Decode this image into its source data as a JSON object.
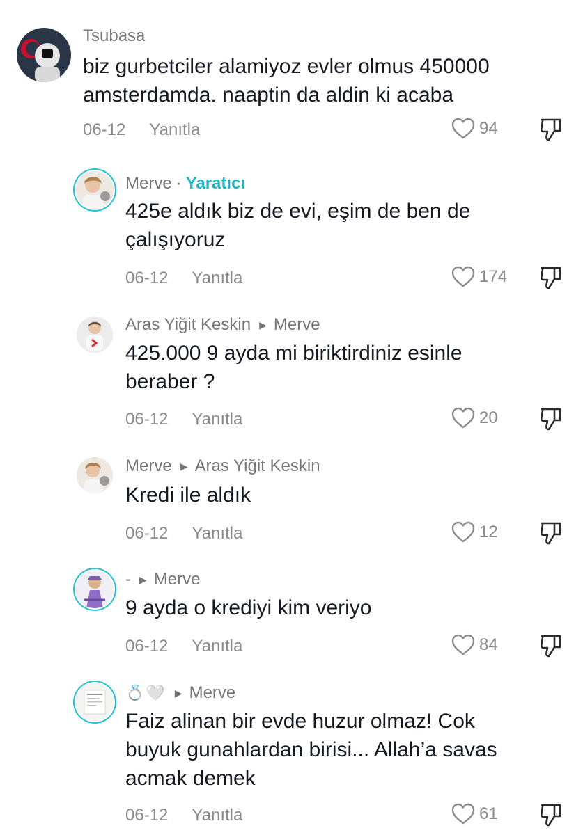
{
  "comments": [
    {
      "username": "Tsubasa",
      "text_lines": [
        "biz gurbetciler alamiyoz evler olmus 450000",
        "amsterdamda. naaptin da aldin ki acaba"
      ],
      "date": "06-12",
      "reply_label": "Yanıtla",
      "likes": "94"
    },
    {
      "username": "Merve",
      "separator": "·",
      "badge": "Yaratıcı",
      "text_lines": [
        "425e aldık biz de evi, eşim de ben de",
        "çalışıyoruz"
      ],
      "date": "06-12",
      "reply_label": "Yanıtla",
      "likes": "174"
    },
    {
      "username": "Aras Yiğit Keskin",
      "reply_to": "Merve",
      "text_lines": [
        "425.000 9 ayda mi biriktirdiniz esinle",
        "beraber ?"
      ],
      "date": "06-12",
      "reply_label": "Yanıtla",
      "likes": "20"
    },
    {
      "username": "Merve",
      "reply_to": "Aras Yiğit Keskin",
      "text_lines": [
        "Kredi ile aldık"
      ],
      "date": "06-12",
      "reply_label": "Yanıtla",
      "likes": "12"
    },
    {
      "username": "-",
      "reply_to": "Merve",
      "text_lines": [
        "9 ayda o krediyi kim veriyo"
      ],
      "date": "06-12",
      "reply_label": "Yanıtla",
      "likes": "84"
    },
    {
      "username": "💍🤍",
      "reply_to": "Merve",
      "text_lines": [
        "Faiz alinan bir evde huzur olmaz! Cok",
        "buyuk gunahlardan birisi... Allah’a savas",
        "acmak demek"
      ],
      "date": "06-12",
      "reply_label": "Yanıtla",
      "likes": "61"
    }
  ],
  "icons": {
    "reply_arrow": "triangle-right-icon",
    "like": "heart-outline-icon",
    "dislike": "thumbs-down-icon"
  },
  "colors": {
    "text": "#161823",
    "muted": "#8a8b91",
    "creator_badge": "#20b5c6",
    "creator_ring": "#20c1d0"
  }
}
